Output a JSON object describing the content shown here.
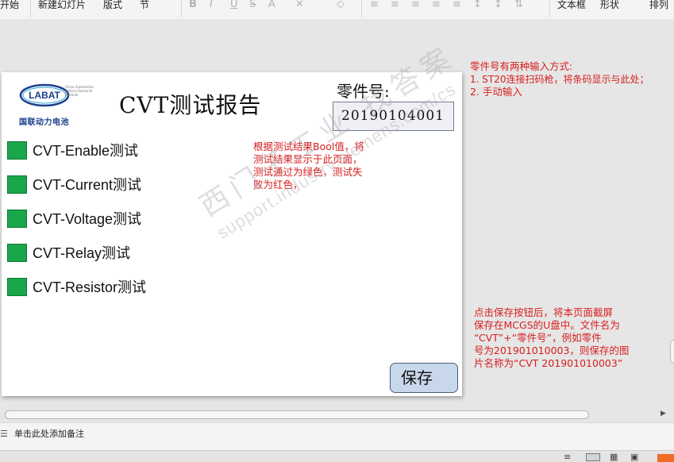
{
  "ribbon": {
    "items": [
      "开始",
      "新建幻灯片",
      "版式",
      "节"
    ],
    "format_icons": [
      "B",
      "I",
      "U",
      "S",
      "A",
      "✕",
      "◇"
    ],
    "right_items": [
      "文本框",
      "形状",
      "排列"
    ]
  },
  "slide": {
    "logo_text": "LABAT",
    "logo_small": "China Automotive Battery Research Institute",
    "logo_cn": "国联动力电池",
    "title": "CVT测试报告",
    "part_label": "零件号:",
    "part_value": "20190104001",
    "tests": [
      {
        "label": "CVT-Enable测试",
        "status": "pass"
      },
      {
        "label": "CVT-Current测试",
        "status": "pass"
      },
      {
        "label": "CVT-Voltage测试",
        "status": "pass"
      },
      {
        "label": "CVT-Relay测试",
        "status": "pass"
      },
      {
        "label": "CVT-Resistor测试",
        "status": "pass"
      }
    ],
    "note_center": [
      "根据测试结果Bool值，将",
      "测试结果显示于此页面，",
      "测试通过为绿色，测试失",
      "败为红色，"
    ],
    "save_label": "保存"
  },
  "annotations": {
    "part_note": [
      "零件号有两种输入方式:",
      "1. ST20连接扫码枪，将条码显示与此处；",
      "2. 手动输入"
    ],
    "save_note": [
      "点击保存按钮后，将本页面截屏",
      "保存在MCGS的U盘中。文件名为",
      "“CVT”+“零件号”，例如零件",
      "号为201901010003，则保存的图",
      "片名称为“CVT 201901010003”"
    ]
  },
  "watermark": {
    "line1": "西门子工业  找答案",
    "line2": "support.industry.siemens.com/cs"
  },
  "notes_pane": {
    "placeholder": "单击此处添加备注"
  },
  "colors": {
    "pass": "#1aa64a",
    "annotation": "#d81e1e",
    "save_button": "#c9d7ec"
  }
}
